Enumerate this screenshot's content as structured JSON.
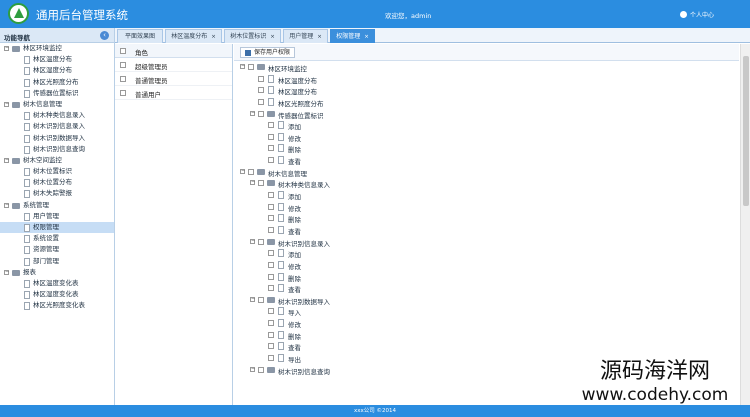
{
  "header": {
    "app_title": "通用后台管理系统",
    "welcome": "欢迎您，admin",
    "user_menu": "个人中心"
  },
  "sidebar": {
    "title": "功能导航",
    "items": [
      {
        "label": "林区环境监控",
        "type": "folder",
        "level": 0,
        "expanded": true
      },
      {
        "label": "林区温度分布",
        "type": "doc",
        "level": 1
      },
      {
        "label": "林区湿度分布",
        "type": "doc",
        "level": 1
      },
      {
        "label": "林区光照度分布",
        "type": "doc",
        "level": 1
      },
      {
        "label": "传感器位置标识",
        "type": "doc",
        "level": 1
      },
      {
        "label": "树木信息管理",
        "type": "folder",
        "level": 0,
        "expanded": true
      },
      {
        "label": "树木种类信息录入",
        "type": "doc",
        "level": 1
      },
      {
        "label": "树木识别信息录入",
        "type": "doc",
        "level": 1
      },
      {
        "label": "树木识别数据导入",
        "type": "doc",
        "level": 1
      },
      {
        "label": "树木识别信息查询",
        "type": "doc",
        "level": 1
      },
      {
        "label": "树木空间监控",
        "type": "folder",
        "level": 0,
        "expanded": true
      },
      {
        "label": "树木位置标识",
        "type": "doc",
        "level": 1
      },
      {
        "label": "树木位置分布",
        "type": "doc",
        "level": 1
      },
      {
        "label": "树木失踪警报",
        "type": "doc",
        "level": 1
      },
      {
        "label": "系统管理",
        "type": "folder",
        "level": 0,
        "expanded": true
      },
      {
        "label": "用户管理",
        "type": "doc",
        "level": 1
      },
      {
        "label": "权限管理",
        "type": "doc",
        "level": 1,
        "selected": true
      },
      {
        "label": "系统设置",
        "type": "doc",
        "level": 1
      },
      {
        "label": "资源管理",
        "type": "doc",
        "level": 1
      },
      {
        "label": "部门管理",
        "type": "doc",
        "level": 1
      },
      {
        "label": "报表",
        "type": "folder",
        "level": 0,
        "expanded": true
      },
      {
        "label": "林区温度变化表",
        "type": "doc",
        "level": 1
      },
      {
        "label": "林区湿度变化表",
        "type": "doc",
        "level": 1
      },
      {
        "label": "林区光照度变化表",
        "type": "doc",
        "level": 1
      }
    ]
  },
  "tabs": [
    {
      "label": "平面效果图",
      "closable": false,
      "active": false
    },
    {
      "label": "林区温度分布",
      "closable": true,
      "active": false
    },
    {
      "label": "树木位置标识",
      "closable": true,
      "active": false
    },
    {
      "label": "用户管理",
      "closable": true,
      "active": false
    },
    {
      "label": "权限管理",
      "closable": true,
      "active": true
    }
  ],
  "roles": {
    "header": "角色",
    "rows": [
      "超级管理员",
      "普通管理员",
      "普通用户"
    ]
  },
  "permissions": {
    "save_label": "保存用户权限",
    "tree": [
      {
        "label": "林区环境监控",
        "level": 0,
        "type": "folder"
      },
      {
        "label": "林区温度分布",
        "level": 1,
        "type": "doc"
      },
      {
        "label": "林区湿度分布",
        "level": 1,
        "type": "doc"
      },
      {
        "label": "林区光照度分布",
        "level": 1,
        "type": "doc"
      },
      {
        "label": "传感器位置标识",
        "level": 1,
        "type": "folder"
      },
      {
        "label": "添加",
        "level": 2,
        "type": "doc"
      },
      {
        "label": "修改",
        "level": 2,
        "type": "doc"
      },
      {
        "label": "删除",
        "level": 2,
        "type": "doc"
      },
      {
        "label": "查看",
        "level": 2,
        "type": "doc"
      },
      {
        "label": "树木信息管理",
        "level": 0,
        "type": "folder"
      },
      {
        "label": "树木种类信息录入",
        "level": 1,
        "type": "folder"
      },
      {
        "label": "添加",
        "level": 2,
        "type": "doc"
      },
      {
        "label": "修改",
        "level": 2,
        "type": "doc"
      },
      {
        "label": "删除",
        "level": 2,
        "type": "doc"
      },
      {
        "label": "查看",
        "level": 2,
        "type": "doc"
      },
      {
        "label": "树木识别信息录入",
        "level": 1,
        "type": "folder"
      },
      {
        "label": "添加",
        "level": 2,
        "type": "doc"
      },
      {
        "label": "修改",
        "level": 2,
        "type": "doc"
      },
      {
        "label": "删除",
        "level": 2,
        "type": "doc"
      },
      {
        "label": "查看",
        "level": 2,
        "type": "doc"
      },
      {
        "label": "树木识别数据导入",
        "level": 1,
        "type": "folder"
      },
      {
        "label": "导入",
        "level": 2,
        "type": "doc"
      },
      {
        "label": "修改",
        "level": 2,
        "type": "doc"
      },
      {
        "label": "删除",
        "level": 2,
        "type": "doc"
      },
      {
        "label": "查看",
        "level": 2,
        "type": "doc"
      },
      {
        "label": "导出",
        "level": 2,
        "type": "doc"
      },
      {
        "label": "树木识别信息查询",
        "level": 1,
        "type": "folder"
      }
    ]
  },
  "footer": "xxx公司 ©2014",
  "watermark": {
    "line1": "源码海洋网",
    "line2": "www.codehy.com"
  },
  "colors": {
    "header": "#2b8de0",
    "active_tab": "#3b8fdc",
    "selected_row": "#c6ddf5"
  }
}
